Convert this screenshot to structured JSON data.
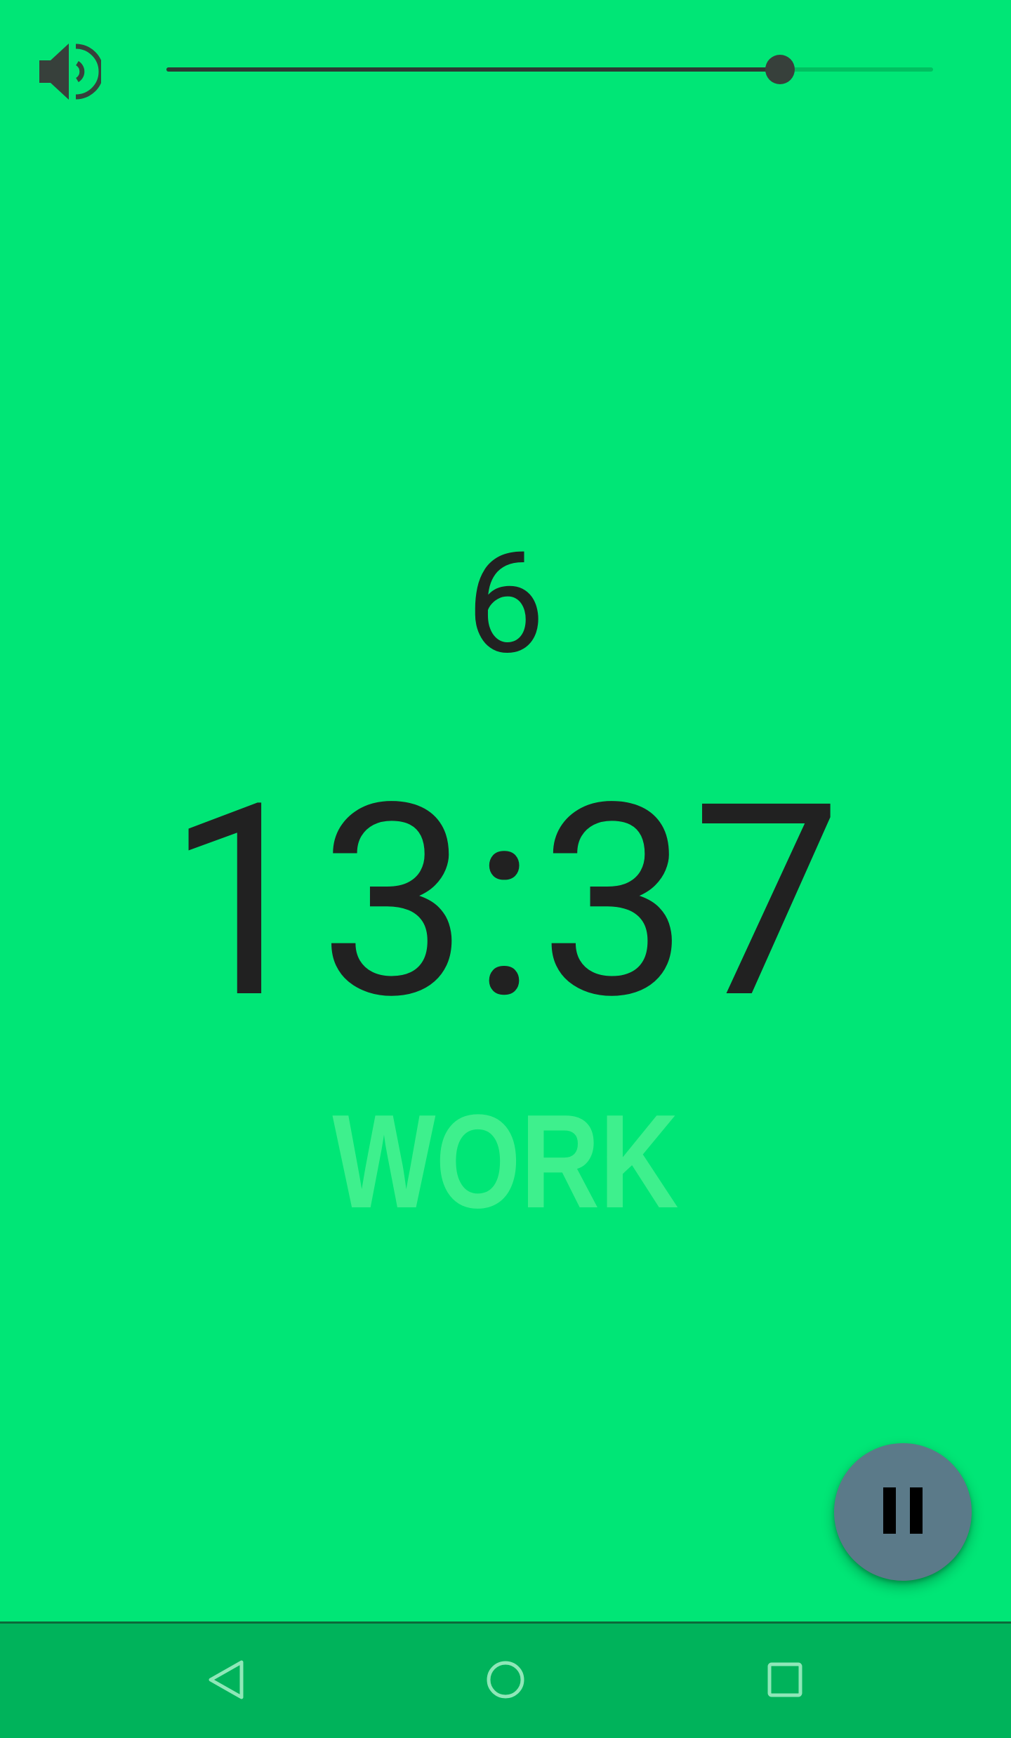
{
  "volume": {
    "icon": "volume-up-icon",
    "level_fraction": 0.8
  },
  "workout": {
    "round": "6",
    "time": "13:37",
    "phase": "WORK"
  },
  "controls": {
    "pause_icon": "pause-icon"
  },
  "navigation": {
    "back_icon": "back-triangle-icon",
    "home_icon": "home-circle-icon",
    "recents_icon": "recents-square-icon"
  },
  "colors": {
    "background": "#00e676",
    "text": "#212121",
    "phase_label": "#3ef08d",
    "fab": "#5b7a89",
    "nav_bar": "#00b35b"
  }
}
